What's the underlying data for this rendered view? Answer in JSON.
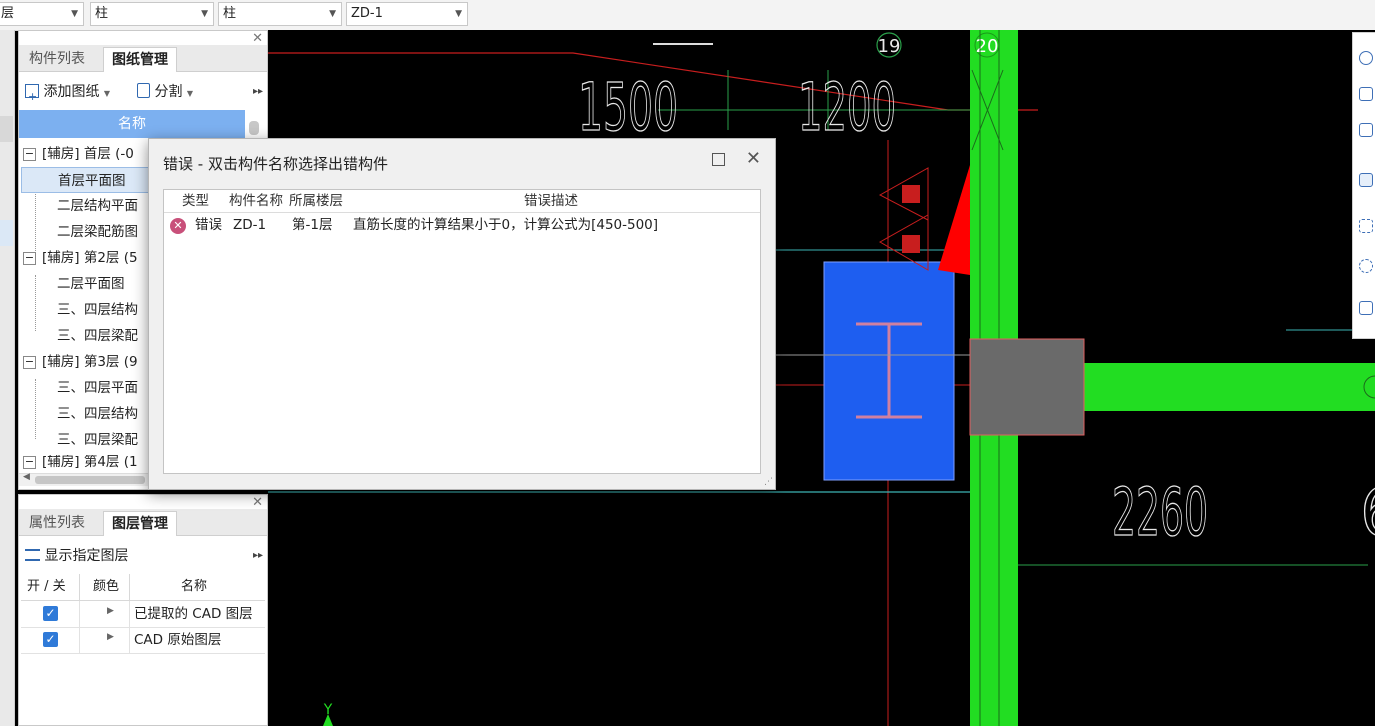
{
  "toolbar": {
    "combos": [
      {
        "value": "层"
      },
      {
        "value": "柱"
      },
      {
        "value": "柱"
      },
      {
        "value": "ZD-1"
      }
    ]
  },
  "drawing_panel": {
    "tabs": [
      "构件列表",
      "图纸管理"
    ],
    "active_tab": "图纸管理",
    "add_label": "添加图纸",
    "split_label": "分割",
    "column_header": "名称",
    "rows": [
      {
        "label": "[辅房] 首层 (-0",
        "group": true
      },
      {
        "label": "首层平面图",
        "selected": true
      },
      {
        "label": "二层结构平面"
      },
      {
        "label": "二层梁配筋图"
      },
      {
        "label": "[辅房] 第2层 (5",
        "group": true
      },
      {
        "label": "二层平面图"
      },
      {
        "label": "三、四层结构"
      },
      {
        "label": "三、四层梁配"
      },
      {
        "label": "[辅房] 第3层 (9",
        "group": true
      },
      {
        "label": "三、四层平面"
      },
      {
        "label": "三、四层结构"
      },
      {
        "label": "三、四层梁配"
      },
      {
        "label": "[辅房] 第4层 (1",
        "group": true
      }
    ]
  },
  "layer_panel": {
    "tabs": [
      "属性列表",
      "图层管理"
    ],
    "active_tab": "图层管理",
    "show_label": "显示指定图层",
    "headers": {
      "toggle": "开 / 关",
      "color": "颜色",
      "name": "名称"
    },
    "rows": [
      {
        "checked": true,
        "name": "已提取的 CAD 图层"
      },
      {
        "checked": true,
        "name": "CAD 原始图层"
      }
    ]
  },
  "error_dialog": {
    "title": "错误 - 双击构件名称选择出错构件",
    "columns": {
      "type": "类型",
      "name": "构件名称",
      "floor": "所属楼层",
      "desc": "错误描述"
    },
    "rows": [
      {
        "type": "错误",
        "name": "ZD-1",
        "floor": "第-1层",
        "desc": "直筋长度的计算结果小于0，计算公式为[450-500]"
      }
    ]
  },
  "canvas": {
    "axis_labels": [
      "19",
      "20"
    ],
    "dimensions": [
      "1500",
      "1200",
      "2260",
      "6"
    ],
    "y_axis": "Y",
    "colors": {
      "background": "#000000",
      "wall": "#22dd22",
      "column": "#1e5ef0",
      "grid_red": "#c81e1e",
      "grid_cyan": "#3cb4b4",
      "gray_block": "#6a6a6a"
    }
  }
}
